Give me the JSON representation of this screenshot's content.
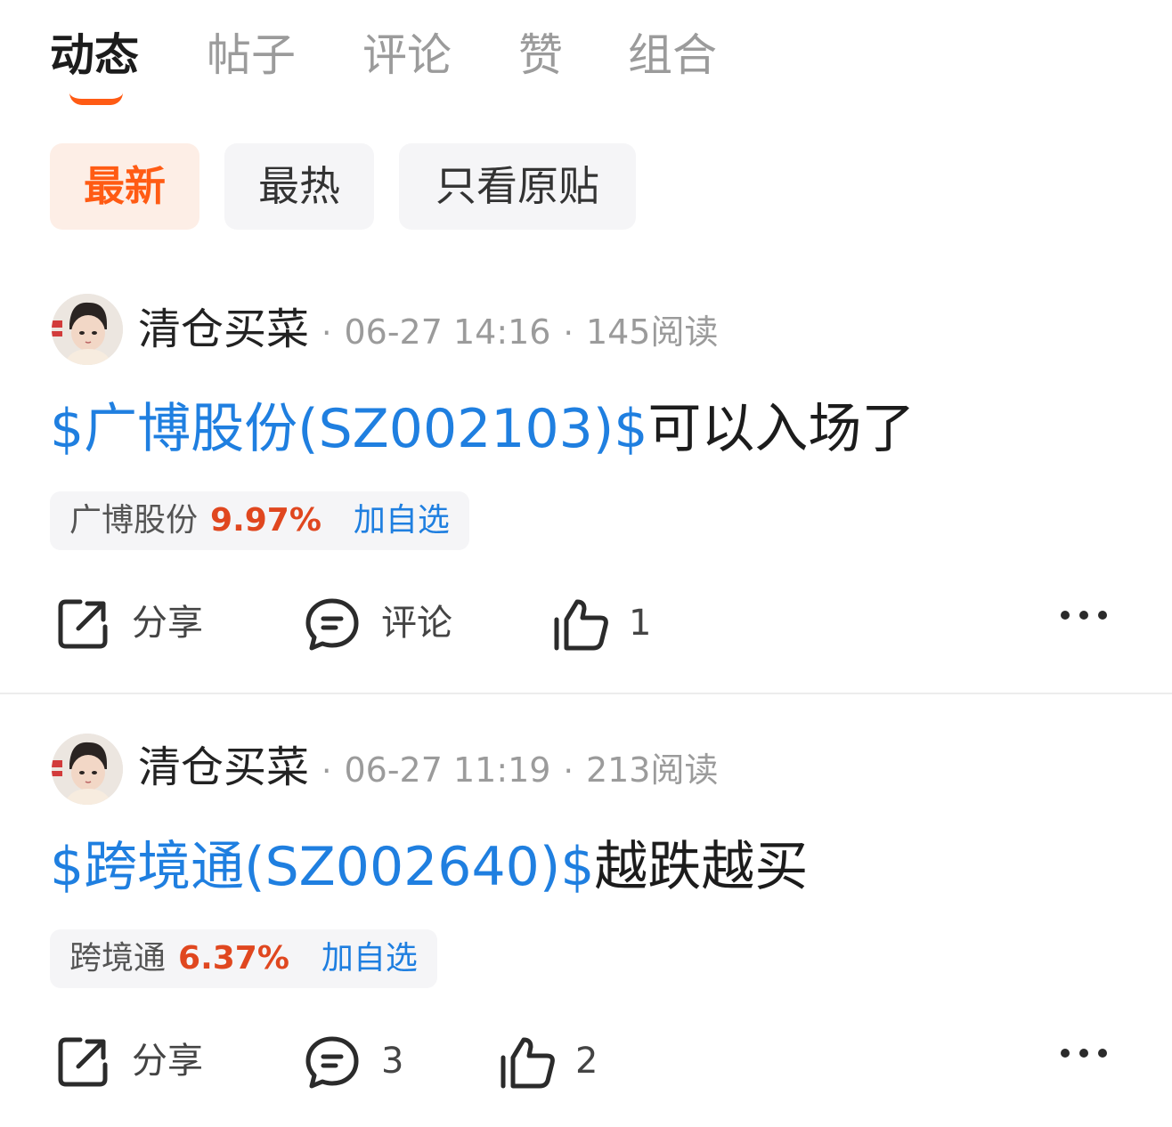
{
  "tabs": [
    {
      "label": "动态"
    },
    {
      "label": "帖子"
    },
    {
      "label": "评论"
    },
    {
      "label": "赞"
    },
    {
      "label": "组合"
    }
  ],
  "active_tab": "动态",
  "accent_color": "#ff5b14",
  "link_color": "#1f7fe0",
  "filters": [
    {
      "label": "最新"
    },
    {
      "label": "最热"
    },
    {
      "label": "只看原贴"
    }
  ],
  "active_filter": "最新",
  "posts": [
    {
      "author": "清仓买菜",
      "separator": "·",
      "time": "06-27 14:16",
      "reads": "145阅读",
      "stock_link": "$广博股份(SZ002103)$",
      "text": "可以入场了",
      "stock_card": {
        "name": "广博股份",
        "change": "9.97%",
        "action": "加自选"
      },
      "actions": {
        "share": "分享",
        "comment": "评论",
        "like": "1"
      },
      "icons": [
        "share-icon",
        "comment-icon",
        "like-icon",
        "more-icon"
      ]
    },
    {
      "author": "清仓买菜",
      "separator": "·",
      "time": "06-27 11:19",
      "reads": "213阅读",
      "stock_link": "$跨境通(SZ002640)$",
      "text": "越跌越买",
      "stock_card": {
        "name": "跨境通",
        "change": "6.37%",
        "action": "加自选"
      },
      "actions": {
        "share": "分享",
        "comment": "3",
        "like": "2"
      },
      "icons": [
        "share-icon",
        "comment-icon",
        "like-icon",
        "more-icon"
      ]
    }
  ]
}
